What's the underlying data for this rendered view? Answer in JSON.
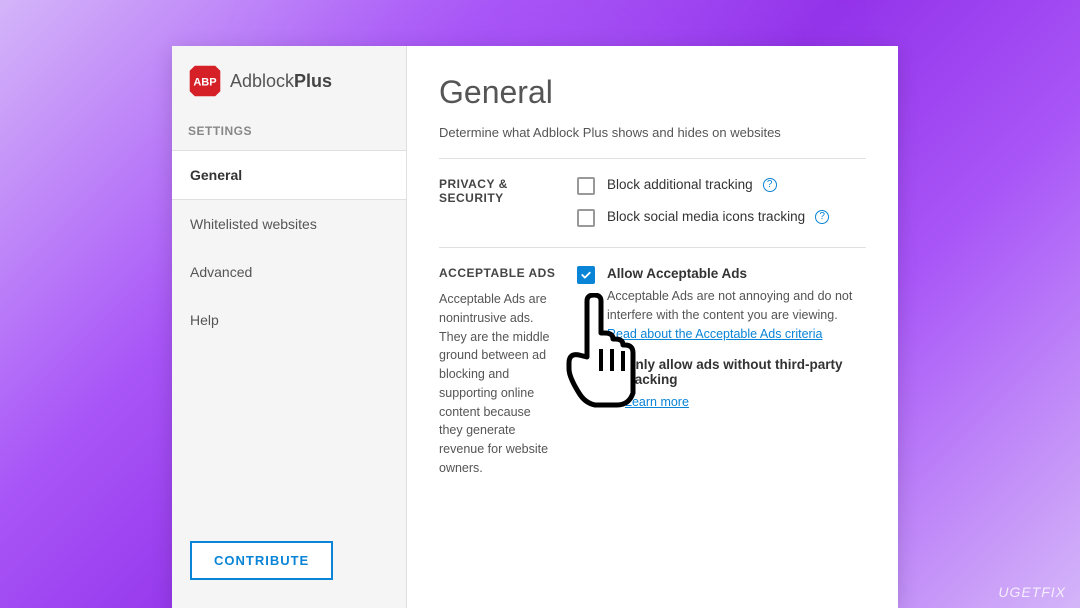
{
  "logo": {
    "brand_prefix": "Adblock",
    "brand_suffix": "Plus",
    "badge_text": "ABP"
  },
  "sidebar": {
    "section_title": "SETTINGS",
    "items": [
      {
        "label": "General",
        "active": true
      },
      {
        "label": "Whitelisted websites",
        "active": false
      },
      {
        "label": "Advanced",
        "active": false
      },
      {
        "label": "Help",
        "active": false
      }
    ],
    "contribute_label": "CONTRIBUTE"
  },
  "main": {
    "title": "General",
    "subtitle": "Determine what Adblock Plus shows and hides on websites"
  },
  "privacy": {
    "title": "PRIVACY & SECURITY",
    "options": [
      {
        "label": "Block additional tracking",
        "checked": false
      },
      {
        "label": "Block social media icons tracking",
        "checked": false
      }
    ]
  },
  "acceptable": {
    "title": "ACCEPTABLE ADS",
    "description": "Acceptable Ads are nonintrusive ads. They are the middle ground between ad blocking and supporting online content because they generate revenue for website owners.",
    "option": {
      "label": "Allow Acceptable Ads",
      "description": "Acceptable Ads are not annoying and do not interfere with the content you are viewing. ",
      "link_text": "Read about the Acceptable Ads criteria"
    },
    "sub": {
      "title": "Only allow ads without third-party tracking",
      "learn": "Learn more"
    }
  },
  "watermark": "UGETFIX"
}
